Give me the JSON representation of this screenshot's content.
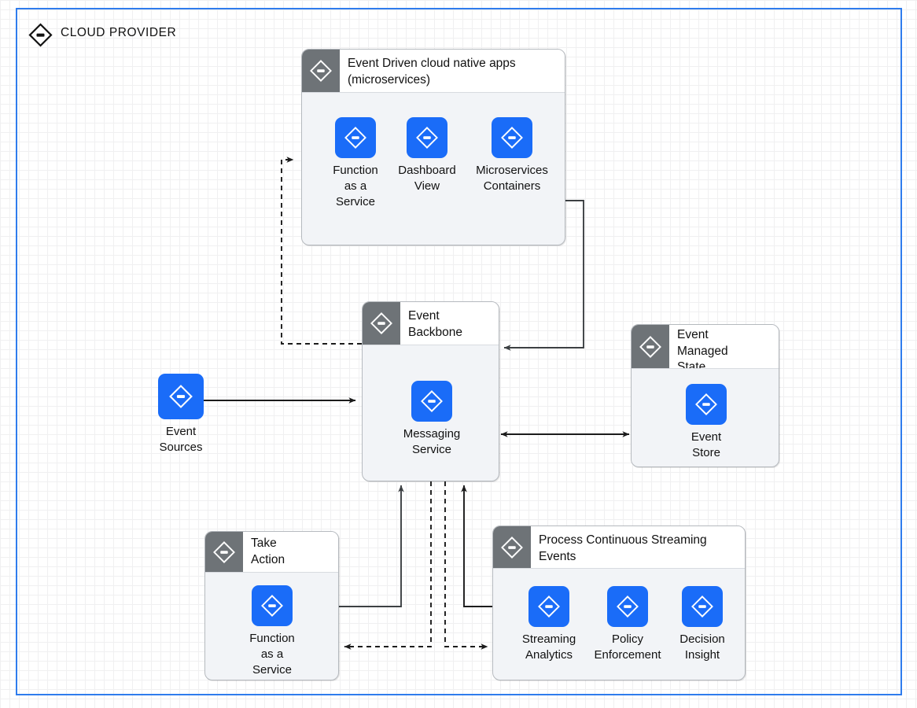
{
  "diagram": {
    "title": "CLOUD PROVIDER",
    "boundary_color": "#2f7ced",
    "tile_color": "#1a6cf8",
    "header_band_color": "#6e7377",
    "icon_name": "diamond-dash-icon"
  },
  "groups": {
    "microservices": {
      "title": "Event Driven cloud native apps (microservices)",
      "tiles": [
        {
          "label": "Function\nas a\nService"
        },
        {
          "label": "Dashboard\nView"
        },
        {
          "label": "Microservices\nContainers"
        }
      ]
    },
    "event_backbone": {
      "title": "Event\nBackbone",
      "tiles": [
        {
          "label": "Messaging\nService"
        }
      ]
    },
    "event_managed_state": {
      "title": "Event\nManaged\nState",
      "tiles": [
        {
          "label": "Event\nStore"
        }
      ]
    },
    "take_action": {
      "title": "Take\nAction",
      "tiles": [
        {
          "label": "Function\nas a\nService"
        }
      ]
    },
    "process_streaming": {
      "title": "Process Continuous Streaming Events",
      "tiles": [
        {
          "label": "Streaming\nAnalytics"
        },
        {
          "label": "Policy\nEnforcement"
        },
        {
          "label": "Decision\nInsight"
        }
      ]
    }
  },
  "standalone": {
    "event_sources": {
      "label": "Event\nSources"
    }
  },
  "connectors": [
    {
      "name": "event-sources-to-backbone",
      "style": "solid",
      "arrows": "end"
    },
    {
      "name": "backbone-to-microservices",
      "style": "dashed",
      "arrows": "end"
    },
    {
      "name": "microservices-to-backbone",
      "style": "solid",
      "arrows": "end"
    },
    {
      "name": "backbone-to-event-store",
      "style": "solid",
      "arrows": "both"
    },
    {
      "name": "take-action-to-backbone",
      "style": "solid",
      "arrows": "end"
    },
    {
      "name": "backbone-to-take-action",
      "style": "dashed",
      "arrows": "end"
    },
    {
      "name": "backbone-to-streaming",
      "style": "dashed",
      "arrows": "end"
    },
    {
      "name": "streaming-to-backbone",
      "style": "solid",
      "arrows": "end"
    }
  ]
}
